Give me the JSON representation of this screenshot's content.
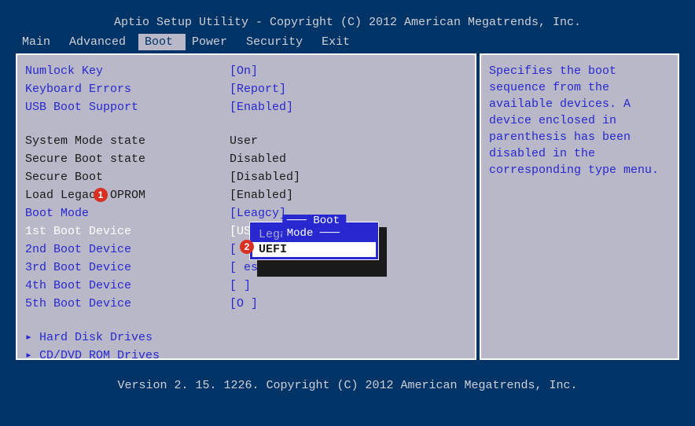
{
  "header": "Aptio Setup Utility - Copyright (C) 2012 American Megatrends, Inc.",
  "tabs": {
    "main": "Main",
    "advanced": "Advanced",
    "boot": "Boot",
    "power": "Power",
    "security": "Security",
    "exit": "Exit"
  },
  "settings": {
    "numlock": {
      "label": "Numlock Key",
      "value": "[On]"
    },
    "keyboard_errors": {
      "label": "Keyboard Errors",
      "value": "[Report]"
    },
    "usb_boot": {
      "label": "USB Boot Support",
      "value": "[Enabled]"
    },
    "system_mode": {
      "label": "System Mode state",
      "value": "User"
    },
    "secure_boot_state": {
      "label": "Secure Boot state",
      "value": "Disabled"
    },
    "secure_boot": {
      "label": "Secure Boot",
      "value": "[Disabled]"
    },
    "load_legacy": {
      "label": "Load Legacy OPROM",
      "value": "[Enabled]"
    },
    "boot_mode": {
      "label": "Boot Mode",
      "value": "[Leagcy]"
    },
    "boot_1": {
      "label": "1st Boot Device",
      "value": "[USB Storage Device]"
    },
    "boot_2": {
      "label": "2nd Boot Device",
      "value": "[            ices: P...]"
    },
    "boot_3": {
      "label": "3rd Boot Device",
      "value": "[             es: W...]"
    },
    "boot_4": {
      "label": "4th Boot Device",
      "value": "[             ]"
    },
    "boot_5": {
      "label": "5th Boot Device",
      "value": "[O           ]"
    }
  },
  "submenus": {
    "hdd": "▸ Hard Disk Drives",
    "cdrom": "▸ CD/DVD ROM Drives"
  },
  "popup": {
    "title": "Boot Mode",
    "options": {
      "legacy": "Legacy",
      "uefi": "UEFI"
    }
  },
  "help": "Specifies the boot sequence from the available devices. A device enclosed in parenthesis has been disabled in the corresponding type menu.",
  "footer": "Version 2. 15. 1226. Copyright (C) 2012 American Megatrends, Inc.",
  "markers": {
    "m1": "1",
    "m2": "2"
  }
}
